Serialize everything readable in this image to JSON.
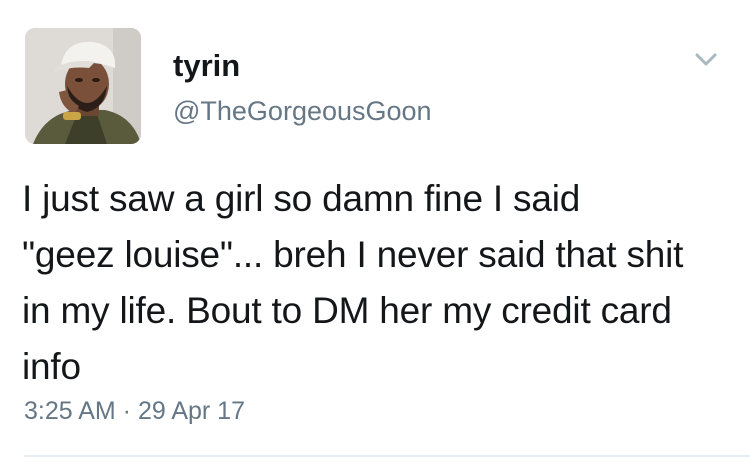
{
  "tweet": {
    "user": {
      "name": "tyrin",
      "handle": "@TheGorgeousGoon"
    },
    "text": "I just saw a girl so damn fine I said\n\"geez louise\"... breh I never said that shit\nin my life. Bout to DM her my credit card\ninfo",
    "timestamp": "3:25 AM · 29 Apr 17",
    "icons": {
      "menu": "chevron-down-icon",
      "avatar": "profile-photo"
    },
    "colors": {
      "text": "#14171a",
      "secondary": "#657786",
      "chevron": "#aab8c2",
      "divider": "#e6ecf0"
    }
  }
}
